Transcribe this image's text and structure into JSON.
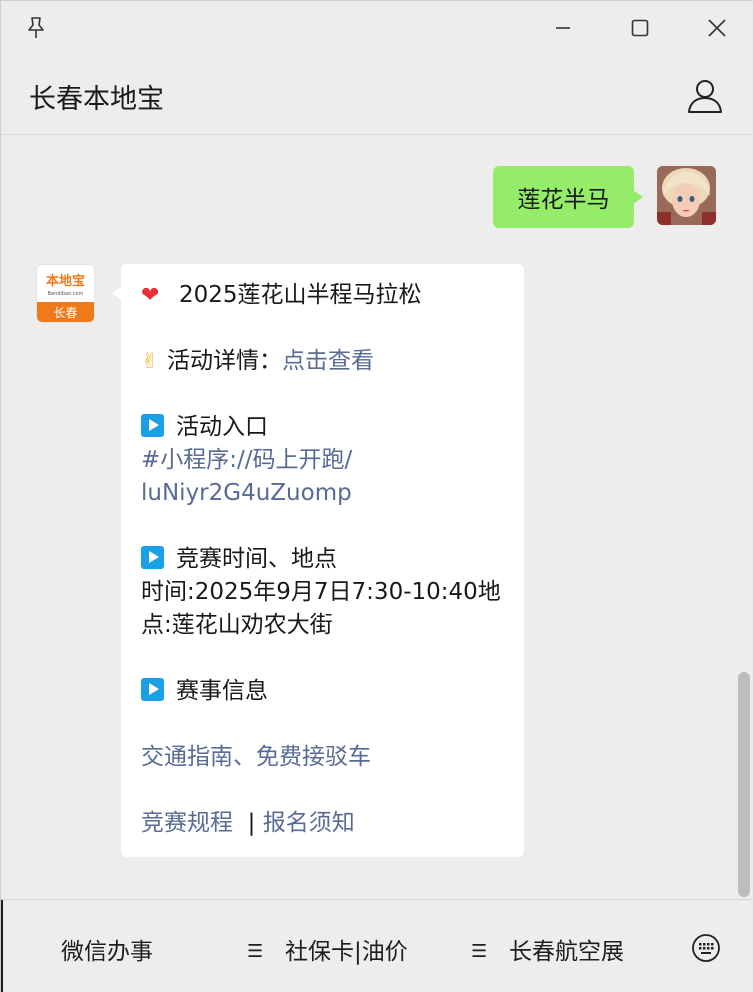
{
  "window": {
    "title": "长春本地宝"
  },
  "chat": {
    "my_message": "莲花半马",
    "reply": {
      "title": "2025莲花山半程马拉松",
      "detail_label": "活动详情：",
      "detail_link": "点击查看",
      "entry_label": "活动入口",
      "entry_link_1": "#小程序://码上开跑/",
      "entry_link_2": "luNiyr2G4uZuomp",
      "time_place_label": "竞赛时间、地点",
      "time_place_line_1": "时间:2025年9月7日7:30-10:40地",
      "time_place_line_2": "点:莲花山劝农大街",
      "event_info_label": "赛事信息",
      "traffic_link": "交通指南、免费接驳车",
      "rules_link": "竞赛规程",
      "separator": "|",
      "signup_link": "报名须知"
    },
    "bot_avatar": {
      "brand_top": "本地宝",
      "brand_small": "Bendibao.com",
      "brand_city": "长春"
    }
  },
  "bottom_menu": {
    "item_1": "微信办事",
    "item_2": "社保卡|油价",
    "item_3": "长春航空展"
  },
  "icons": {
    "pin": "pin-icon",
    "minimize": "minimize-icon",
    "maximize": "maximize-icon",
    "close": "close-icon",
    "user": "user-icon",
    "keyboard": "keyboard-icon",
    "heart": "heart-icon",
    "hand": "victory-hand-icon",
    "play": "play-icon"
  },
  "colors": {
    "my_bubble": "#95ec69",
    "link": "#576b95",
    "play_icon": "#1aa0e6",
    "brand_orange": "#f07a1a"
  }
}
